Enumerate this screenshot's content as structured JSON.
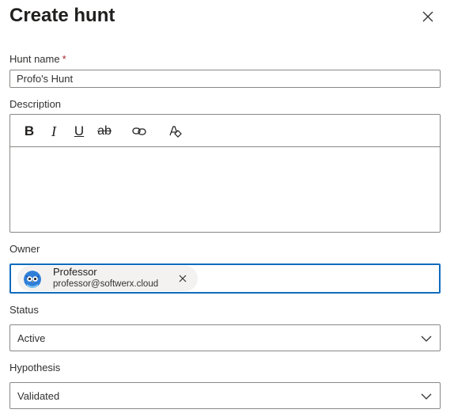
{
  "panel": {
    "title": "Create hunt"
  },
  "form": {
    "hunt_name": {
      "label": "Hunt name",
      "required_marker": "*",
      "value": "Profo's Hunt"
    },
    "description": {
      "label": "Description",
      "toolbar": {
        "bold": "B",
        "italic": "I",
        "underline": "U",
        "strikethrough": "ab",
        "link_icon": "link-icon",
        "clear_format_icon": "clear-format-icon"
      },
      "value": ""
    },
    "owner": {
      "label": "Owner",
      "persona": {
        "name": "Professor",
        "email": "professor@softwerx.cloud"
      }
    },
    "status": {
      "label": "Status",
      "selected": "Active"
    },
    "hypothesis": {
      "label": "Hypothesis",
      "selected": "Validated"
    }
  },
  "colors": {
    "focus_border": "#0f6cbd",
    "border": "#8a8886",
    "required": "#a4262c",
    "chip_bg": "#f3f2f1"
  }
}
